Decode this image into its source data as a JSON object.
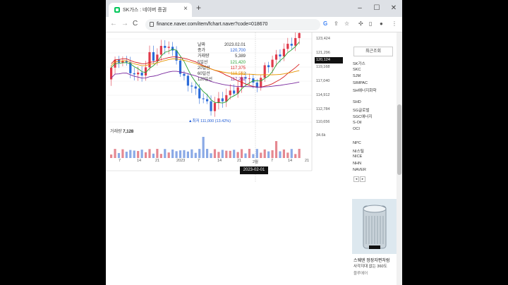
{
  "browser": {
    "tab_title": "SK가스 : 네이버 증권",
    "url": "finance.naver.com/item/fchart.naver?code=018670",
    "nav_back": "←",
    "nav_forward": "→",
    "nav_reload": "C",
    "new_tab": "+",
    "tab_close": "×"
  },
  "chart": {
    "price_ticks": [
      "123,424",
      "121,296",
      "119,168",
      "117,040",
      "114,912",
      "112,784",
      "110,656"
    ],
    "current_price": "120,124",
    "volume_max": "34.6k",
    "x_ticks": [
      "7",
      "14",
      "21",
      "2023",
      "7",
      "14",
      "21",
      "2월",
      "7",
      "14",
      "21"
    ],
    "cursor_date": "2023-02-01",
    "low_label": "▲최저 111,000 (13.42%)",
    "volume_title": "거래량",
    "volume_value": "7,128",
    "info": [
      {
        "label": "날짜",
        "value": "2023.02.01",
        "color": "#333333"
      },
      {
        "label": "종가",
        "value": "120,700",
        "color": "#1e5bd6"
      },
      {
        "label": "거래량",
        "value": "5,389",
        "color": "#333333"
      },
      {
        "label": "5일선",
        "value": "121,420",
        "color": "#27a032"
      },
      {
        "label": "20일선",
        "value": "117,375",
        "color": "#d81e1e"
      },
      {
        "label": "60일선",
        "value": "119,592",
        "color": "#e69500"
      },
      {
        "label": "120일선",
        "value": "117,292",
        "color": "#7a2a9e"
      }
    ],
    "colors": {
      "up": "#e0394a",
      "down": "#2b6bd9",
      "ma5": "#27a032",
      "ma20": "#d81e1e",
      "ma60": "#e69500",
      "ma120": "#7a2a9e",
      "vol_up": "#e58891",
      "vol_down": "#8aa9e6"
    }
  },
  "sidebar": {
    "header": "최근조회",
    "group1": [
      "SK가스",
      "SKC",
      "SJM",
      "SIMPAC",
      "SH에너지화학"
    ],
    "group2": [
      "SHD",
      "SG글로벌",
      "SGC에너지",
      "S-Oil",
      "OCI"
    ],
    "group3": [
      "NPC",
      "NI스틸",
      "NICE",
      "NHN",
      "NAVER"
    ],
    "pager": [
      "◂",
      "▸"
    ],
    "ad_title": "스웨덴 정장자편처럼",
    "ad_sub": "사각지대 없는 360도",
    "ad_brand": "블루에어"
  }
}
